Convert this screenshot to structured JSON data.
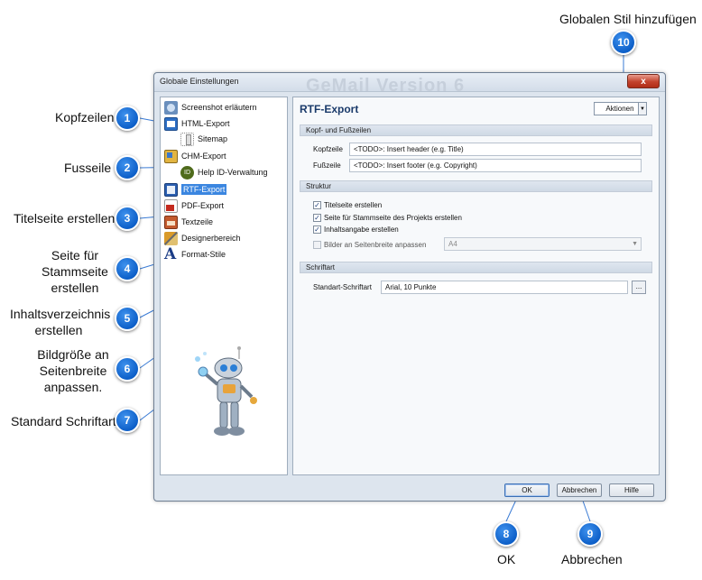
{
  "annotations": {
    "global_style": "Globalen Stil hinzufügen",
    "kopfzeilen": "Kopfzeilen",
    "fusszeile": "Fusseile",
    "titelseite": "Titelseite erstellen",
    "stammseite": [
      "Seite für",
      "Stammseite",
      "erstellen"
    ],
    "inhalt": [
      "Inhaltsverzeichnis",
      "erstellen"
    ],
    "bildgroesse": [
      "Bildgröße an",
      "Seitenbreite",
      "anpassen."
    ],
    "schriftart": "Standard Schriftart",
    "ok": "OK",
    "abbrechen": "Abbrechen",
    "badges": [
      "1",
      "2",
      "3",
      "4",
      "5",
      "6",
      "7",
      "8",
      "9",
      "10"
    ]
  },
  "window": {
    "title": "Globale Einstellungen",
    "watermark": "GeMail Version 6",
    "close_symbol": "x"
  },
  "tree": {
    "items": [
      {
        "label": "Screenshot erläutern",
        "icon": "screenshot-icon"
      },
      {
        "label": "HTML-Export",
        "icon": "html-export-icon"
      },
      {
        "label": "Sitemap",
        "icon": "sitemap-icon"
      },
      {
        "label": "CHM-Export",
        "icon": "chm-export-icon"
      },
      {
        "label": "Help ID-Verwaltung",
        "icon": "help-id-icon"
      },
      {
        "label": "RTF-Export",
        "icon": "rtf-export-icon",
        "selected": true
      },
      {
        "label": "PDF-Export",
        "icon": "pdf-export-icon"
      },
      {
        "label": "Textzeile",
        "icon": "textzeile-icon"
      },
      {
        "label": "Designerbereich",
        "icon": "designer-icon"
      },
      {
        "label": "Format-Stile",
        "icon": "format-styles-icon"
      }
    ]
  },
  "panel": {
    "title": "RTF-Export",
    "aktionen": "Aktionen",
    "dropdown_symbol": "▼",
    "sec_header": "Kopf- und Fußzeilen",
    "kopfzeile_label": "Kopfzeile",
    "kopfzeile_value": "<TODO>: Insert header (e.g. Title)",
    "fusszeile_label": "Fußzeile",
    "fusszeile_value": "<TODO>: Insert footer (e.g. Copyright)",
    "sec_struktur": "Struktur",
    "chk_titelseite": "Titelseite erstellen",
    "chk_stammseite": "Seite für Stammseite des Projekts erstellen",
    "chk_inhalt": "Inhaltsangabe erstellen",
    "chk_bilder": "Bilder an Seitenbreite anpassen",
    "check_mark": "✓",
    "format_value": "A4",
    "sec_schriftart": "Schriftart",
    "schriftart_label": "Standart-Schriftart",
    "schriftart_value": "Arial, 10 Punkte",
    "dots_label": "..."
  },
  "buttons": {
    "ok": "OK",
    "abbrechen": "Abbrechen",
    "hilfe": "Hilfe"
  },
  "colors": {
    "badge_blue": "#1a6fd8",
    "selection_blue": "#3b86e0",
    "close_red": "#c2412b"
  }
}
